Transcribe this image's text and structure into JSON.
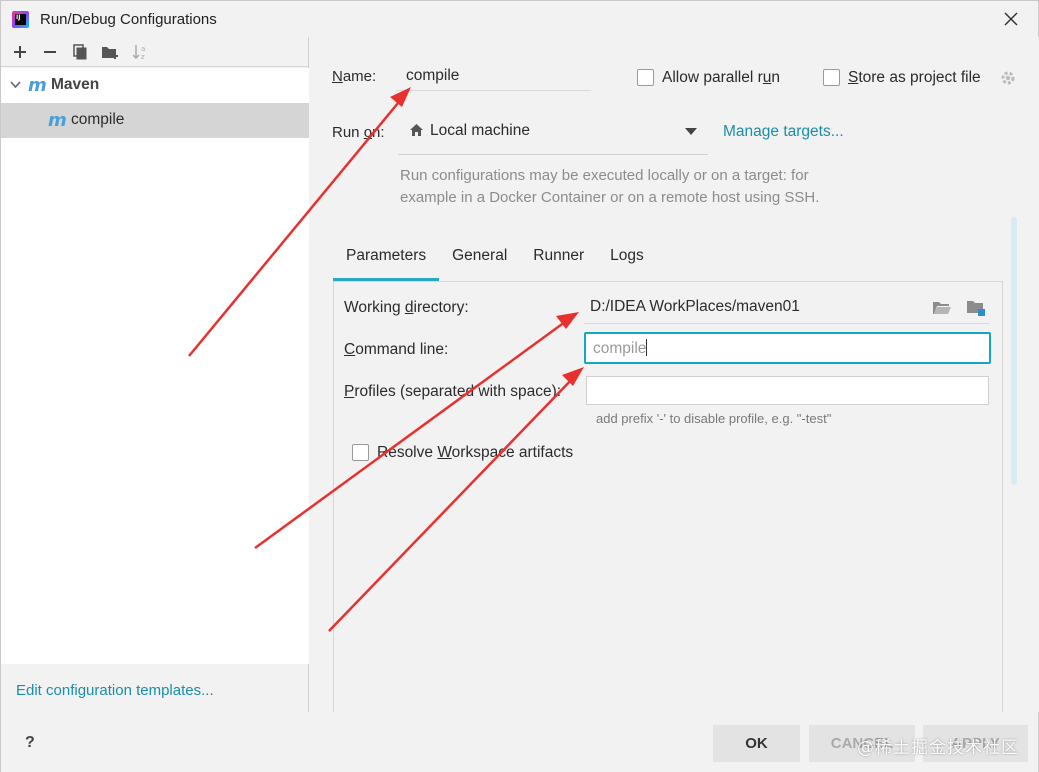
{
  "window": {
    "title": "Run/Debug Configurations"
  },
  "sidebar": {
    "group_label": "Maven",
    "item_label": "compile",
    "edit_templates_link": "Edit configuration templates..."
  },
  "config": {
    "name_label": "Name:",
    "name_value": "compile",
    "allow_parallel_label": "Allow parallel run",
    "allow_parallel_checked": false,
    "store_project_label": "Store as project file",
    "store_project_checked": false,
    "run_on_label": "Run on:",
    "run_on_value": "Local machine",
    "manage_targets_link": "Manage targets...",
    "hint_line1": "Run configurations may be executed locally or on a target: for",
    "hint_line2": "example in a Docker Container or on a remote host using SSH."
  },
  "tabs": [
    {
      "label": "Parameters",
      "active": true
    },
    {
      "label": "General",
      "active": false
    },
    {
      "label": "Runner",
      "active": false
    },
    {
      "label": "Logs",
      "active": false
    }
  ],
  "parameters": {
    "working_dir_label": "Working directory:",
    "working_dir_value": "D:/IDEA WorkPlaces/maven01",
    "command_line_label": "Command line:",
    "command_line_value": "compile",
    "profiles_label": "Profiles (separated with space):",
    "profiles_value": "",
    "profiles_hint": "add prefix '-' to disable profile, e.g. \"-test\"",
    "resolve_workspace_label": "Resolve Workspace artifacts",
    "resolve_workspace_checked": false
  },
  "footer": {
    "help_label": "?",
    "ok_label": "OK",
    "cancel_label": "CANCEL",
    "apply_label": "APPLY",
    "watermark": "@稀土掘金技术社区"
  },
  "colors": {
    "accent": "#14a7c2",
    "link": "#1a8fa8",
    "arrow": "#e8312f",
    "maven_icon": "#4a9fd8"
  }
}
